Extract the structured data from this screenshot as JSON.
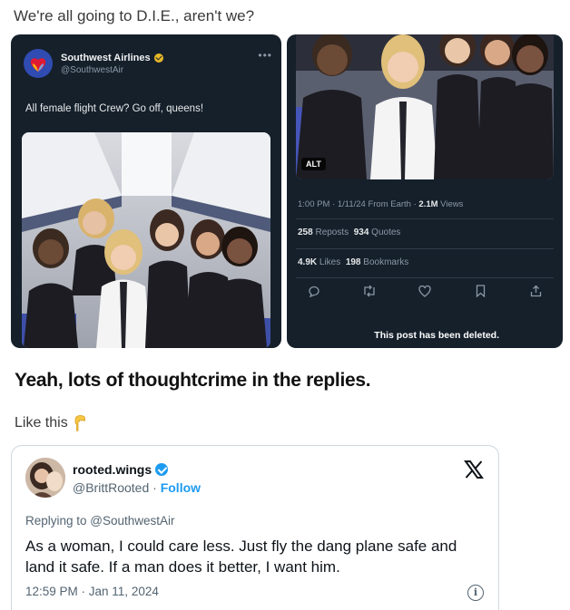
{
  "caption": {
    "top": "We're all going to D.I.E., aren't we?",
    "middle": "Yeah, lots of thoughtcrime in the replies.",
    "like_this": "Like this"
  },
  "left_tweet": {
    "account_name": "Southwest Airlines",
    "account_handle": "@SouthwestAir",
    "text": "All female flight Crew? Go off, queens!"
  },
  "right_tweet": {
    "alt_badge": "ALT",
    "timestamp": "1:00 PM · 1/11/24 From Earth · ",
    "views_count": "2.1M",
    "views_label": " Views",
    "reposts_count": "258",
    "reposts_label": " Reposts",
    "quotes_count": "934",
    "quotes_label": " Quotes",
    "likes_count": "4.9K",
    "likes_label": " Likes",
    "bookmarks_count": "198",
    "bookmarks_label": " Bookmarks",
    "deleted_notice": "This post has been deleted."
  },
  "reply_tweet": {
    "display_name": "rooted.wings",
    "handle": "@BrittRooted",
    "separator": " · ",
    "follow_label": "Follow",
    "replying_to": "Replying to @SouthwestAir",
    "body": "As a woman, I could care less. Just fly the dang plane safe and land it safe. If a man does it better, I want him.",
    "timestamp": "12:59 PM · Jan 11, 2024",
    "info_glyph": "i"
  },
  "icons": [
    "southwest-heart-icon",
    "verified-gold-icon",
    "more-dots-icon",
    "reply-icon",
    "repost-icon",
    "like-icon",
    "bookmark-icon",
    "share-icon",
    "pointing-down-emoji-icon",
    "verified-blue-icon",
    "x-logo-icon",
    "info-icon"
  ],
  "colors": {
    "dark_card": "#15202b",
    "x_blue": "#1d9bf0",
    "southwest_blue": "#304cb2",
    "southwest_red": "#e01933",
    "southwest_yellow": "#f9b612"
  }
}
